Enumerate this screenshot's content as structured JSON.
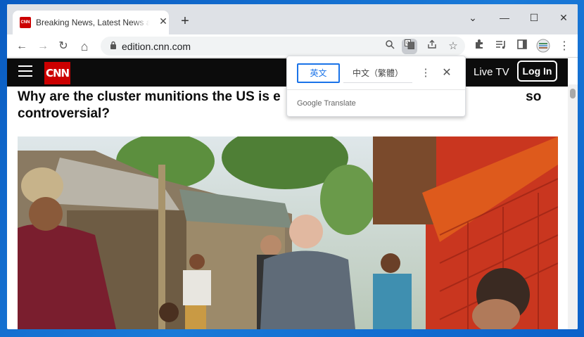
{
  "tab": {
    "title": "Breaking News, Latest News and Videos | CNN",
    "favicon_label": "CNN"
  },
  "window_controls": {
    "minimize": "—",
    "maximize": "☐",
    "close": "✕",
    "tab_search": "⌄"
  },
  "toolbar": {
    "url": "edition.cnn.com",
    "back": "←",
    "forward": "→",
    "reload": "↻",
    "home": "⌂",
    "icons": [
      "search-icon",
      "translate-icon",
      "share-icon",
      "star-icon",
      "extensions-icon",
      "reading-list-icon",
      "side-panel-icon",
      "profile-icon",
      "menu-icon"
    ]
  },
  "cnn_header": {
    "logo": "CNN",
    "live_tv": "Live TV",
    "login": "Log In"
  },
  "article": {
    "headline": "Why are the cluster munitions the US is e                                                                  so controversial?"
  },
  "translate_popup": {
    "source_language": "英文",
    "target_language": "中文（繁體）",
    "branding": "Google Translate"
  },
  "colors": {
    "cnn_red": "#cc0000",
    "translate_blue": "#1a73e8",
    "header_black": "#0c0c0c"
  }
}
